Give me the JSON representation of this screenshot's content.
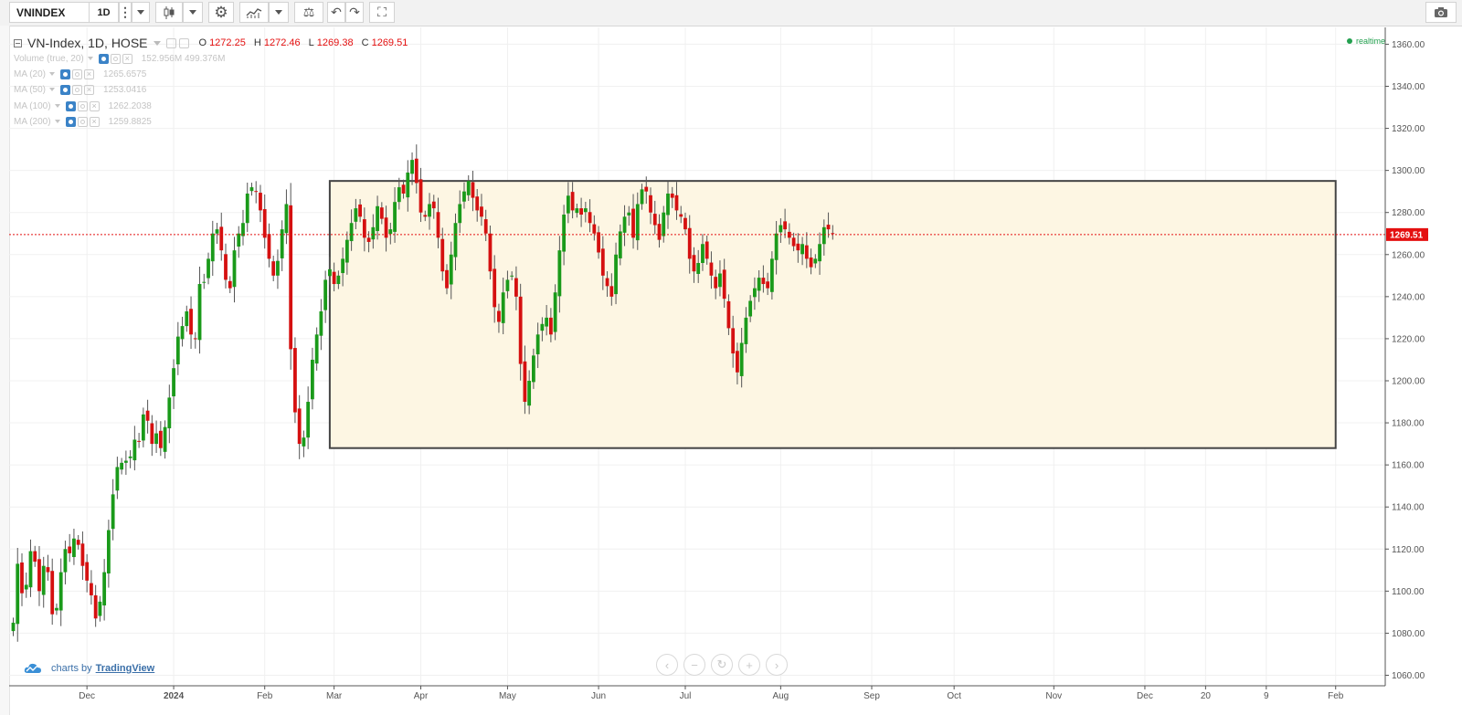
{
  "toolbar": {
    "symbol": "VNINDEX",
    "interval": "1D",
    "more_glyph": "⋮",
    "settings_glyph": "⚙",
    "compare_glyph": "⚖",
    "undo_glyph": "↶",
    "redo_glyph": "↷",
    "fullscreen_glyph": "⛶",
    "snapshot_glyph": "📷"
  },
  "legend": {
    "title": "VN-Index, 1D, HOSE",
    "ohlc": [
      {
        "key": "O",
        "value": "1272.25"
      },
      {
        "key": "H",
        "value": "1272.46"
      },
      {
        "key": "L",
        "value": "1269.38"
      },
      {
        "key": "C",
        "value": "1269.51"
      }
    ],
    "indicators": [
      {
        "name": "Volume (true, 20)",
        "values": "152.956M  499.376M"
      },
      {
        "name": "MA (20)",
        "values": "1265.6575"
      },
      {
        "name": "MA (50)",
        "values": "1253.0416"
      },
      {
        "name": "MA (100)",
        "values": "1262.2038"
      },
      {
        "name": "MA (200)",
        "values": "1259.8825"
      }
    ]
  },
  "realtime_label": "realtime",
  "branding": {
    "prefix": "charts by",
    "name": "TradingView"
  },
  "nav": {
    "left": "‹",
    "zoom_out": "−",
    "reset": "↻",
    "zoom_in": "+",
    "right": "›"
  },
  "colors": {
    "up": "#1a9a1a",
    "down": "#d51010",
    "box_fill": "#fdf6e3",
    "box_border": "#444444",
    "grid": "#f0f0f0",
    "price_line": "#e41010"
  },
  "chart_data": {
    "type": "candlestick",
    "symbol": "VN-Index",
    "interval": "1D",
    "exchange": "HOSE",
    "ylim": [
      1055,
      1368
    ],
    "y_ticks": [
      "1060.00",
      "1080.00",
      "1100.00",
      "1120.00",
      "1140.00",
      "1160.00",
      "1180.00",
      "1200.00",
      "1220.00",
      "1240.00",
      "1260.00",
      "1280.00",
      "1300.00",
      "1320.00",
      "1340.00",
      "1360.00"
    ],
    "x_ticks": [
      {
        "label": "Dec",
        "bar": 17
      },
      {
        "label": "2024",
        "bar": 37
      },
      {
        "label": "Feb",
        "bar": 58
      },
      {
        "label": "Mar",
        "bar": 74
      },
      {
        "label": "Apr",
        "bar": 94
      },
      {
        "label": "May",
        "bar": 114
      },
      {
        "label": "Jun",
        "bar": 135
      },
      {
        "label": "Jul",
        "bar": 155
      },
      {
        "label": "Aug",
        "bar": 177
      },
      {
        "label": "Sep",
        "bar": 198
      },
      {
        "label": "Oct",
        "bar": 217
      },
      {
        "label": "Nov",
        "bar": 240
      },
      {
        "label": "Dec",
        "bar": 261
      },
      {
        "label": "20",
        "bar": 275
      },
      {
        "label": "9",
        "bar": 289
      },
      {
        "label": "Feb",
        "bar": 305
      }
    ],
    "last_price": "1269.51",
    "rectangle": {
      "start_bar": 73,
      "end_bar": 305,
      "top": 1295,
      "bottom": 1168
    },
    "closes": [
      1085,
      1113,
      1099,
      1103,
      1119,
      1114,
      1100,
      1112,
      1109,
      1089,
      1092,
      1109,
      1120,
      1118,
      1125,
      1122,
      1112,
      1105,
      1098,
      1087,
      1095,
      1109,
      1129,
      1146,
      1159,
      1161,
      1162,
      1164,
      1172,
      1171,
      1184,
      1181,
      1170,
      1175,
      1168,
      1178,
      1192,
      1206,
      1221,
      1226,
      1233,
      1222,
      1220,
      1246,
      1247,
      1258,
      1270,
      1272,
      1262,
      1248,
      1244,
      1262,
      1270,
      1275,
      1289,
      1292,
      1290,
      1281,
      1268,
      1258,
      1250,
      1257,
      1272,
      1284,
      1215,
      1185,
      1170,
      1173,
      1190,
      1210,
      1222,
      1233,
      1248,
      1253,
      1246,
      1250,
      1258,
      1267,
      1275,
      1282,
      1278,
      1268,
      1266,
      1273,
      1283,
      1277,
      1268,
      1272,
      1285,
      1292,
      1289,
      1299,
      1305,
      1294,
      1280,
      1278,
      1284,
      1282,
      1268,
      1252,
      1244,
      1260,
      1275,
      1284,
      1290,
      1295,
      1287,
      1281,
      1278,
      1270,
      1252,
      1235,
      1228,
      1242,
      1248,
      1250,
      1240,
      1208,
      1190,
      1200,
      1212,
      1222,
      1227,
      1230,
      1222,
      1242,
      1262,
      1279,
      1288,
      1281,
      1282,
      1279,
      1282,
      1275,
      1270,
      1261,
      1250,
      1245,
      1240,
      1260,
      1271,
      1278,
      1280,
      1268,
      1284,
      1291,
      1290,
      1280,
      1274,
      1267,
      1280,
      1289,
      1287,
      1281,
      1278,
      1272,
      1258,
      1252,
      1256,
      1265,
      1258,
      1250,
      1244,
      1251,
      1239,
      1225,
      1213,
      1204,
      1218,
      1230,
      1238,
      1244,
      1249,
      1246,
      1244,
      1258,
      1270,
      1274,
      1272,
      1268,
      1264,
      1262,
      1265,
      1258,
      1254,
      1258,
      1265,
      1273,
      1272,
      1270
    ]
  }
}
